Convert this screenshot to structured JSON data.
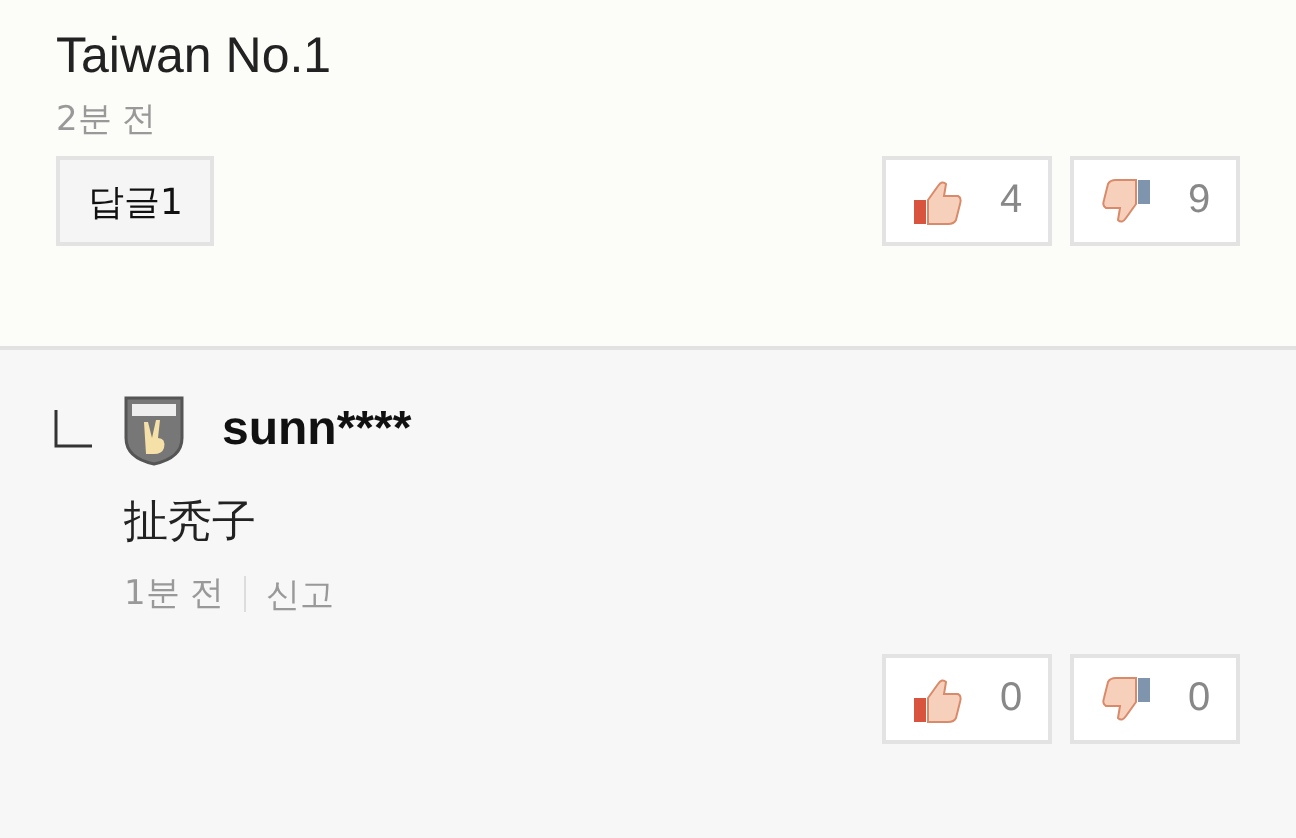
{
  "comment": {
    "text": "Taiwan No.1",
    "time": "2분 전",
    "reply_button": "답글1",
    "likes": "4",
    "dislikes": "9"
  },
  "reply": {
    "username": "sunn****",
    "text": "扯秃子",
    "time": "1분 전",
    "report": "신고",
    "likes": "0",
    "dislikes": "0"
  }
}
